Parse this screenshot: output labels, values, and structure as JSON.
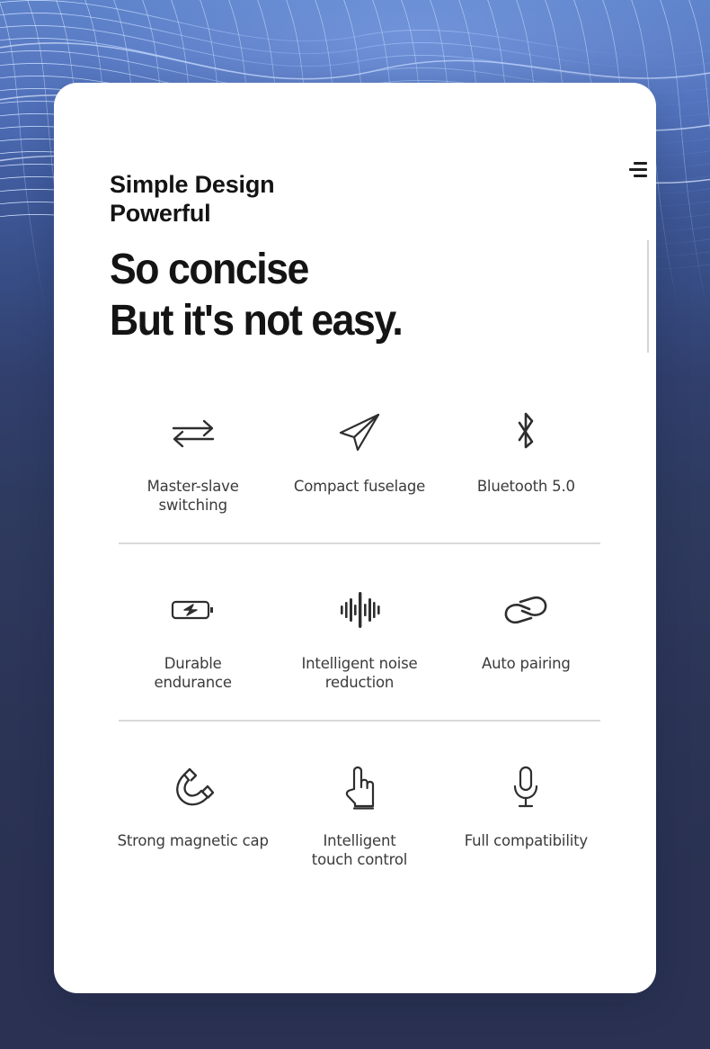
{
  "header": {
    "eyebrow": "Simple Design\nPowerful",
    "headline": "So concise\nBut it's not easy.",
    "menu_icon": "hamburger-menu-icon"
  },
  "colors": {
    "card_background": "#ffffff",
    "text_primary": "#141414",
    "text_secondary": "#3b3b3b",
    "divider": "#d9d9db",
    "accent_line": "#d4d4d6",
    "page_background_top": "#5a7fc4",
    "page_background_bottom": "#2a3152"
  },
  "features": {
    "rows": [
      {
        "cells": [
          {
            "icon": "swap-arrows-icon",
            "label": "Master-slave\nswitching"
          },
          {
            "icon": "paper-plane-icon",
            "label": "Compact fuselage"
          },
          {
            "icon": "bluetooth-icon",
            "label": "Bluetooth 5.0"
          }
        ]
      },
      {
        "cells": [
          {
            "icon": "battery-charging-icon",
            "label": "Durable\nendurance"
          },
          {
            "icon": "sound-wave-icon",
            "label": "Intelligent noise\nreduction"
          },
          {
            "icon": "chain-link-icon",
            "label": "Auto pairing"
          }
        ]
      },
      {
        "cells": [
          {
            "icon": "magnet-icon",
            "label": "Strong magnetic cap"
          },
          {
            "icon": "pointing-hand-icon",
            "label": "Intelligent\ntouch control"
          },
          {
            "icon": "microphone-icon",
            "label": "Full compatibility"
          }
        ]
      }
    ]
  }
}
